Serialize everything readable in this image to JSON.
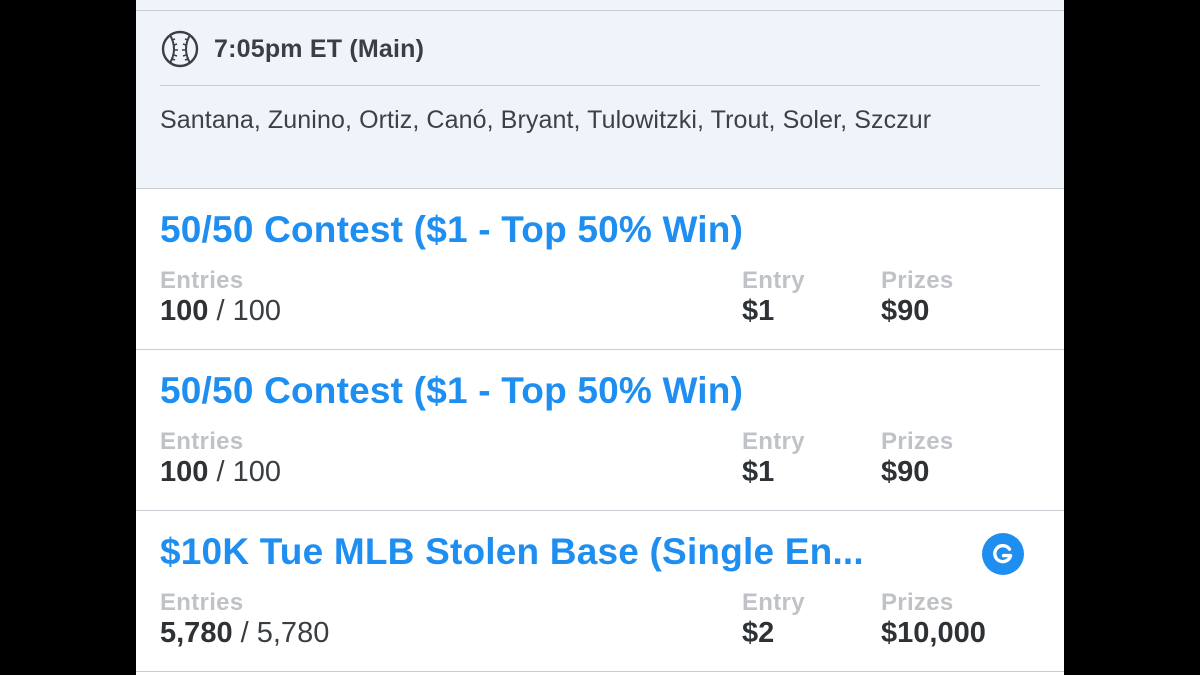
{
  "slate": {
    "time_label": "7:05pm ET (Main)",
    "players": "Santana, Zunino, Ortiz, Canó, Bryant, Tulowitzki, Trout, Soler, Szczur"
  },
  "columns": {
    "entries_label": "Entries",
    "entry_label": "Entry",
    "prizes_label": "Prizes"
  },
  "contests": [
    {
      "title": "50/50 Contest ($1 - Top 50% Win)",
      "entries_filled": "100",
      "entries_sep": " / ",
      "entries_total": "100",
      "entry_fee": "$1",
      "prizes": "$90"
    },
    {
      "title": "50/50 Contest ($1 - Top 50% Win)",
      "entries_filled": "100",
      "entries_sep": " / ",
      "entries_total": "100",
      "entry_fee": "$1",
      "prizes": "$90"
    },
    {
      "title": "$10K Tue MLB Stolen Base (Single En...",
      "entries_filled": "5,780",
      "entries_sep": " / ",
      "entries_total": "5,780",
      "entry_fee": "$2",
      "prizes": "$10,000",
      "badge_icon": "guaranteed-icon"
    }
  ],
  "colors": {
    "accent": "#1f8ef1",
    "header_bg": "#eff3fa",
    "label_gray": "#bfc3c8",
    "text_dark": "#2e3237"
  }
}
